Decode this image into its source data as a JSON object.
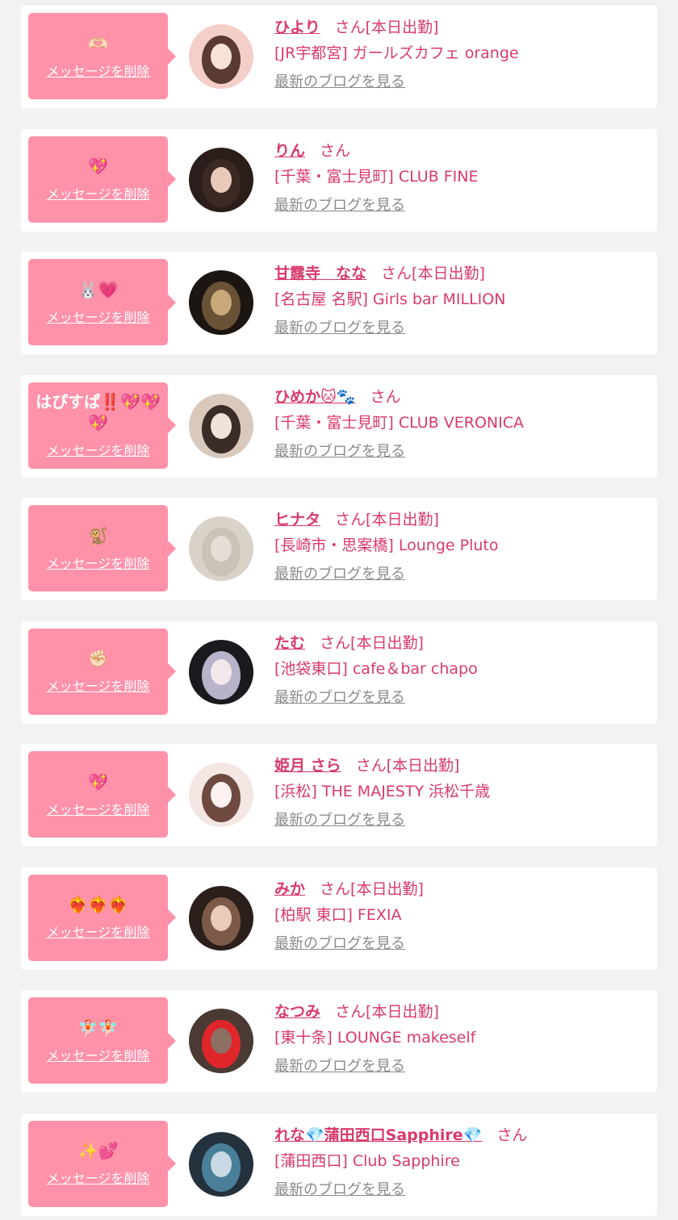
{
  "colors": {
    "accent": "#d93a6a",
    "bubble": "#ff91a9",
    "background": "#f2f2f2",
    "link_gray": "#8a8a8a"
  },
  "delete_label": "メッセージを削除",
  "blog_label": "最新のブログを見る",
  "honorific": "さん",
  "entries": [
    {
      "message": "🫶🏻",
      "message_icon": "heart-hands-icon",
      "name": "ひより",
      "status": "[本日出勤]",
      "shop": "[JR宇都宮] ガールズカフェ orange",
      "avatar_colors": [
        "#f3cfc8",
        "#5a3b33",
        "#f7e2d6"
      ]
    },
    {
      "message": "💖",
      "message_icon": "sparkling-heart-icon",
      "name": "りん",
      "status": "",
      "shop": "[千葉・富士見町] CLUB FINE",
      "avatar_colors": [
        "#2b1e1a",
        "#3b2a24",
        "#e9c9b9"
      ]
    },
    {
      "message": "🐰💗",
      "message_icon": "rabbit-heart-icon",
      "name": "甘露寺　なな",
      "status": "[本日出勤]",
      "shop": "[名古屋 名駅] Girls bar MILLION",
      "avatar_colors": [
        "#1c1612",
        "#6a5236",
        "#c9a87a"
      ]
    },
    {
      "message": "はぴすぱ‼️💖💖💖",
      "message_icon": "sparkling-heart-icon",
      "name": "ひめか🐱🐾",
      "status": "",
      "shop": "[千葉・富士見町] CLUB VERONICA",
      "avatar_colors": [
        "#d9c9bd",
        "#3a2d28",
        "#f1e3d8"
      ]
    },
    {
      "message": "🐒",
      "message_icon": "monkey-icon",
      "name": "ヒナタ",
      "status": "[本日出勤]",
      "shop": "[長崎市・思案橋] Lounge Pluto",
      "avatar_colors": [
        "#d8d2c8",
        "#c9c2b6",
        "#e4dfd6"
      ]
    },
    {
      "message": "✊🏻",
      "message_icon": "raised-fist-icon",
      "name": "たむ",
      "status": "[本日出勤]",
      "shop": "[池袋東口] cafe＆bar chapo",
      "avatar_colors": [
        "#1a1a1e",
        "#b9b3c9",
        "#f2e8ec"
      ]
    },
    {
      "message": "💖",
      "message_icon": "sparkling-heart-icon",
      "name": "姫月 さら",
      "status": "[本日出勤]",
      "shop": "[浜松] THE MAJESTY 浜松千歳",
      "avatar_colors": [
        "#f4e6e3",
        "#6e4a40",
        "#fbf2ef"
      ]
    },
    {
      "message": "❤️‍🔥❤️‍🔥❤️‍🔥",
      "message_icon": "heart-on-fire-icon",
      "name": "みか",
      "status": "[本日出勤]",
      "shop": "[柏駅 東口] FEXIA",
      "avatar_colors": [
        "#2a1f1a",
        "#7d5a48",
        "#e8cbb8"
      ]
    },
    {
      "message": "🧚🏻🧚🏻",
      "message_icon": "fairy-icon",
      "name": "なつみ",
      "status": "[本日出勤]",
      "shop": "[東十条] LOUNGE makeself",
      "avatar_colors": [
        "#4a3a33",
        "#e0262b",
        "#8b6f62"
      ]
    },
    {
      "message": "✨💕",
      "message_icon": "sparkles-hearts-icon",
      "name": "れな💎蒲田西口Sapphire💎",
      "status": "",
      "shop": "[蒲田西口] Club Sapphire",
      "avatar_colors": [
        "#24323d",
        "#4a7f9a",
        "#c9d9e3"
      ]
    }
  ]
}
